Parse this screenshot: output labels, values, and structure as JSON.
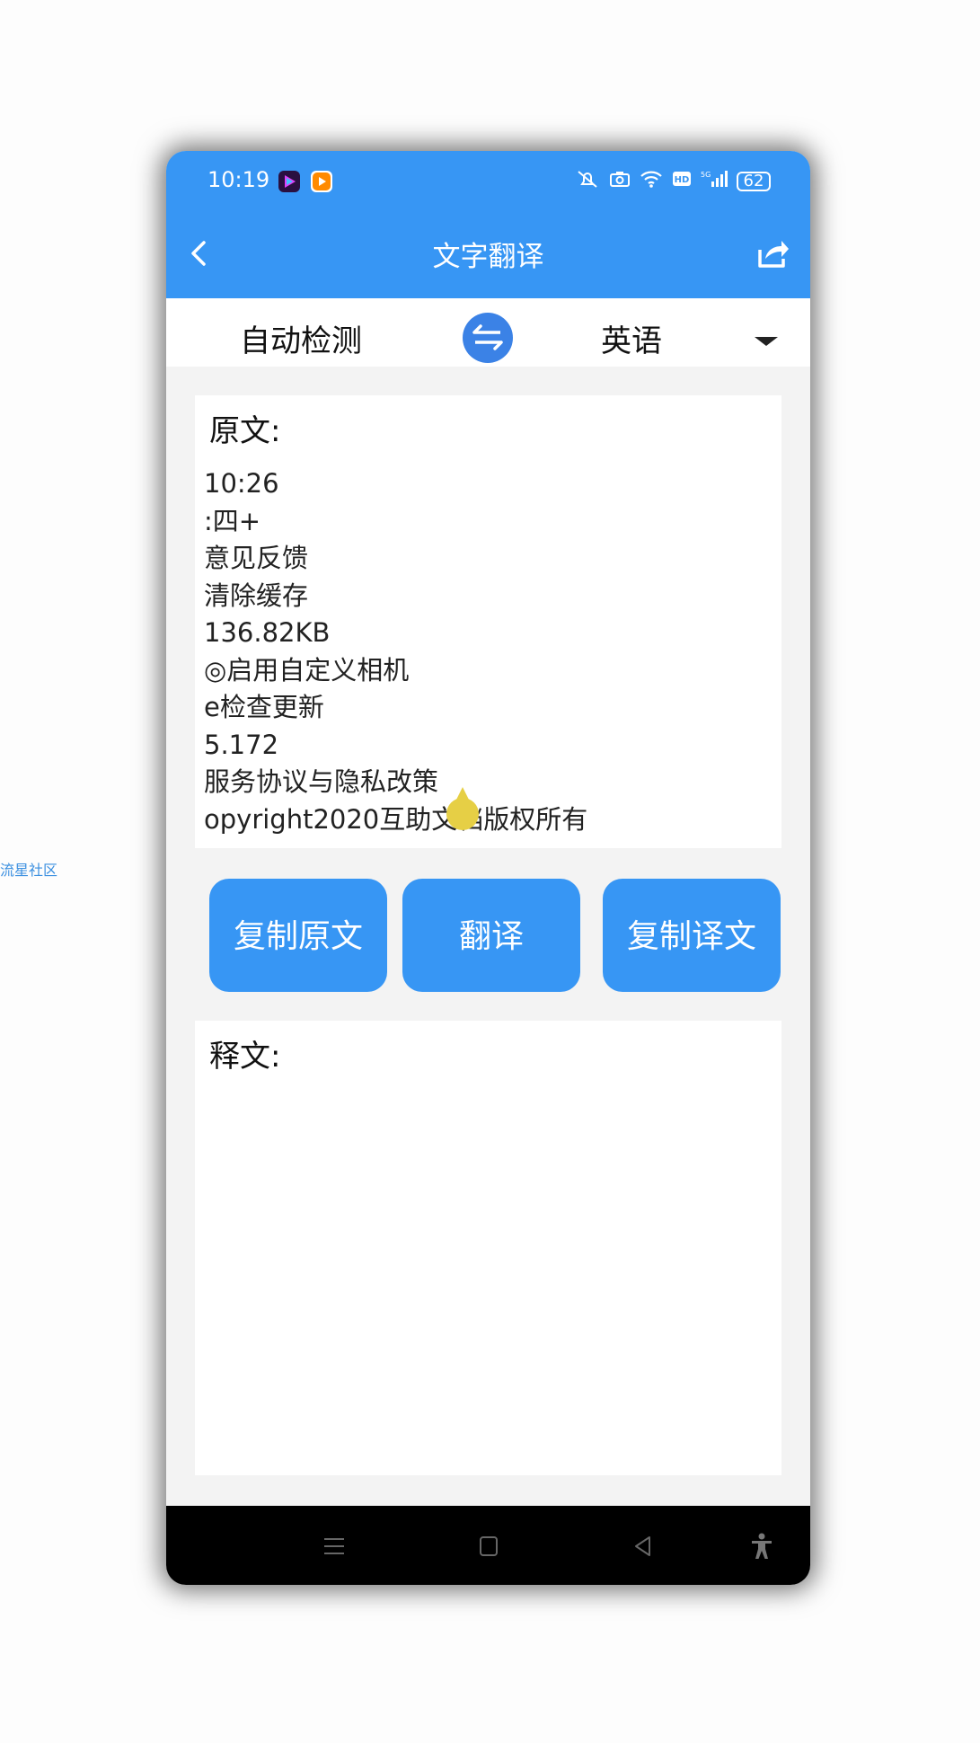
{
  "watermark": "流星社区",
  "status_bar": {
    "time": "10:19",
    "battery": "62",
    "icons": [
      "app-video-icon",
      "app-play-icon",
      "mute-icon",
      "camera-icon",
      "wifi-icon",
      "hd-icon",
      "5g-signal-icon",
      "battery-icon"
    ]
  },
  "app_bar": {
    "title": "文字翻译"
  },
  "lang_bar": {
    "source_lang": "自动检测",
    "target_lang": "英语"
  },
  "source": {
    "label": "原文:",
    "lines": [
      "10:26",
      ":四+",
      "意见反馈",
      "清除缓存",
      "136.82KB",
      "◎启用自定义相机",
      "e检查更新",
      "5.172",
      "服务协议与隐私改策",
      "opyright2020互助文档版权所有"
    ]
  },
  "buttons": {
    "copy_source": "复制原文",
    "translate": "翻译",
    "copy_target": "复制译文"
  },
  "target": {
    "label": "释文:"
  },
  "colors": {
    "primary": "#3796f4",
    "swap": "#3b82e6",
    "cursor": "#e6cf45"
  }
}
